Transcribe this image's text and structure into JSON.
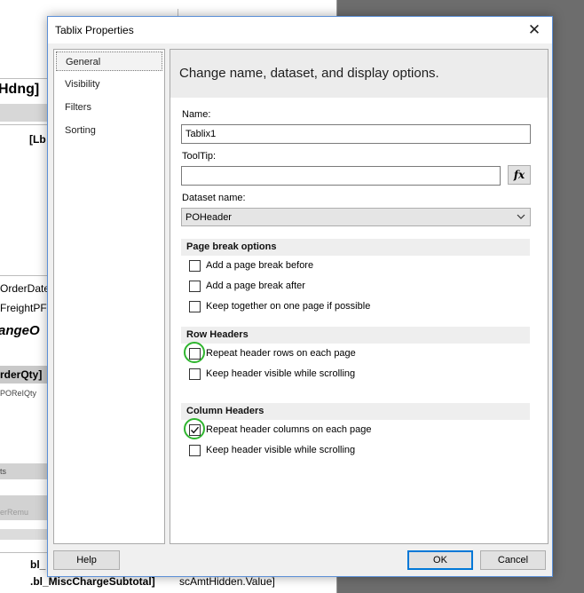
{
  "background": {
    "fragments": [
      "Hdng]",
      "[Lb",
      "OrderDate",
      "FreightPF",
      "angeO",
      "rderQty]",
      "POReIQty",
      "ts",
      "erRemu",
      "bl_",
      ".bl_MiscChargeSubtotal]",
      "scAmtHidden.Value]"
    ]
  },
  "dialog": {
    "title": "Tablix Properties",
    "close_glyph": "✕",
    "nav": {
      "items": [
        "General",
        "Visibility",
        "Filters",
        "Sorting"
      ],
      "selected": "General"
    },
    "header": "Change name, dataset, and display options.",
    "name_label": "Name:",
    "name_value": "Tablix1",
    "tooltip_label": "ToolTip:",
    "tooltip_value": "",
    "fx_label": "fx",
    "dataset_label": "Dataset name:",
    "dataset_value": "POHeader",
    "page_break": {
      "title": "Page break options",
      "options": [
        {
          "label": "Add a page break before",
          "checked": false
        },
        {
          "label": "Add a page break after",
          "checked": false
        },
        {
          "label": "Keep together on one page if possible",
          "checked": false
        }
      ]
    },
    "row_headers": {
      "title": "Row Headers",
      "options": [
        {
          "label": "Repeat header rows on each page",
          "checked": false
        },
        {
          "label": "Keep header visible while scrolling",
          "checked": false
        }
      ]
    },
    "column_headers": {
      "title": "Column Headers",
      "options": [
        {
          "label": "Repeat header columns on each page",
          "checked": true
        },
        {
          "label": "Keep header visible while scrolling",
          "checked": false
        }
      ]
    },
    "buttons": {
      "help": "Help",
      "ok": "OK",
      "cancel": "Cancel"
    },
    "colors": {
      "accent": "#0078d7",
      "highlight": "#2fb52f",
      "border": "#5b8fd6"
    }
  }
}
